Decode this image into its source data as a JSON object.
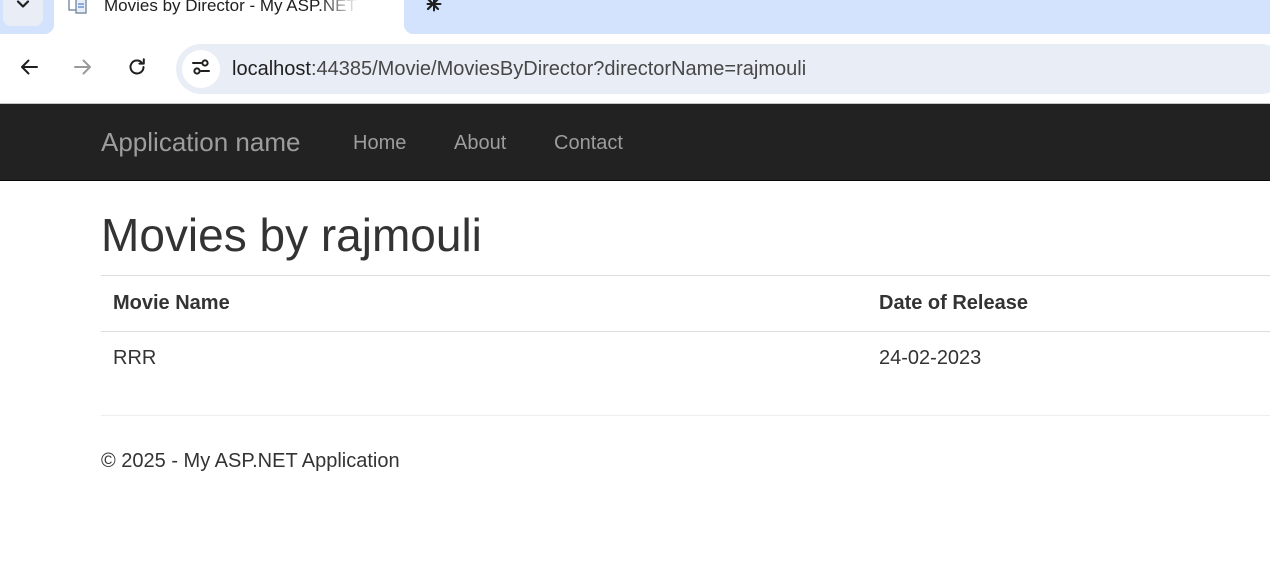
{
  "browser": {
    "tab": {
      "title": "Movies by Director - My ASP.NET Application",
      "favicon": "page-icon"
    },
    "url": {
      "host": "localhost",
      "rest": ":44385/Movie/MoviesByDirector?directorName=rajmouli"
    },
    "icons": {
      "tab_search": "chevron-down-icon",
      "close": "close-icon",
      "new_tab": "plus-icon",
      "back": "back-arrow-icon",
      "forward": "forward-arrow-icon",
      "reload": "reload-icon",
      "site_info": "tune-icon"
    },
    "colors": {
      "tabstrip": "#d3e3fd",
      "omnibox": "#e9eef6"
    }
  },
  "navbar": {
    "brand": "Application name",
    "links": [
      "Home",
      "About",
      "Contact"
    ],
    "colors": {
      "background": "#222222",
      "text": "#9d9d9d"
    }
  },
  "main": {
    "title": "Movies by rajmouli",
    "table": {
      "headers": [
        "Movie Name",
        "Date of Release"
      ],
      "rows": [
        [
          "RRR",
          "24-02-2023"
        ]
      ]
    }
  },
  "footer": {
    "text": "© 2025 - My ASP.NET Application"
  }
}
